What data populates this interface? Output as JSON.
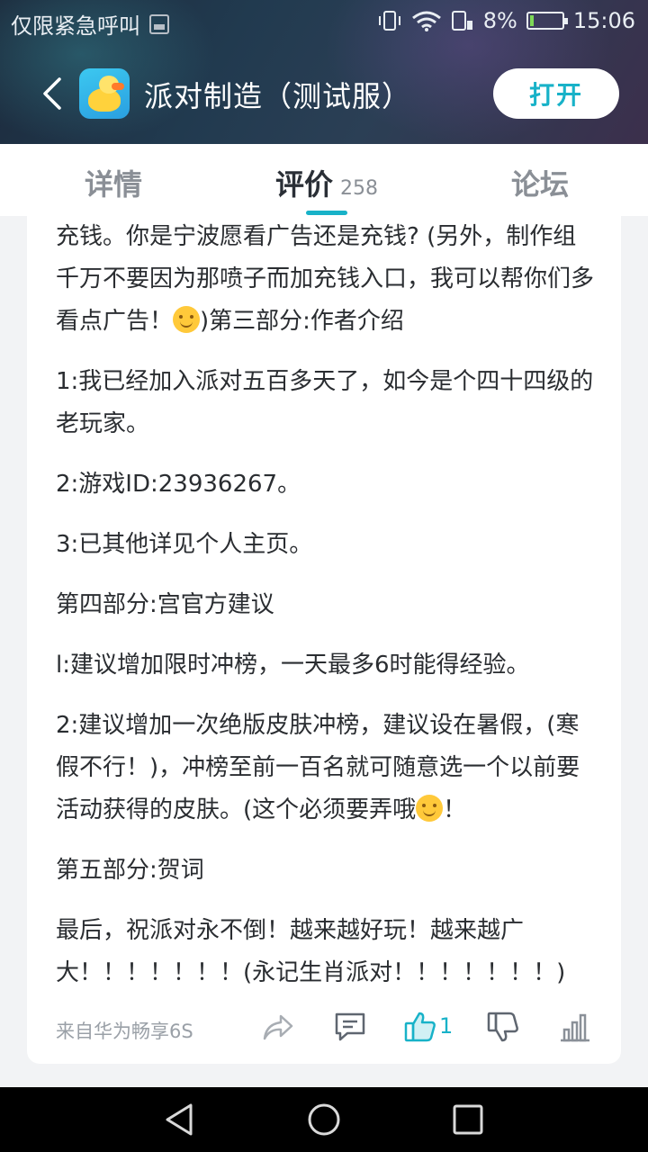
{
  "status_bar": {
    "carrier": "仅限紧急呼叫",
    "battery": "8%",
    "time": "15:06"
  },
  "app_bar": {
    "title": "派对制造（测试服）",
    "open_label": "打开"
  },
  "tabs": {
    "details": "详情",
    "reviews": "评价",
    "reviews_count": "258",
    "forum": "论坛"
  },
  "review": {
    "p1_a": "充钱。你是宁波愿看广告还是充钱? (另外，制作组千万不要因为那喷子而加充钱入口，我可以帮你们多看点广告！",
    "p1_b": ")第三部分:作者介绍",
    "p2": "1:我已经加入派对五百多天了，如今是个四十四级的老玩家。",
    "p3": "2:游戏ID:23936267。",
    "p4": "3:已其他详见个人主页。",
    "p5": "第四部分:宫官方建议",
    "p6": "l:建议增加限时冲榜，一天最多6时能得经验。",
    "p7_a": "2:建议增加一次绝版皮肤冲榜，建议设在暑假，(寒假不行！)，冲榜至前一百名就可随意选一个以前要活动获得的皮肤。(这个必须要弄哦",
    "p7_b": "！",
    "p8": "第五部分:贺词",
    "p9": "最后，祝派对永不倒！越来越好玩！越来越广大！！！！！！！(永记生肖派对！！！！！！！)",
    "device": "来自华为畅享6S",
    "like_count": "1"
  },
  "colors": {
    "accent": "#18b2c8"
  }
}
